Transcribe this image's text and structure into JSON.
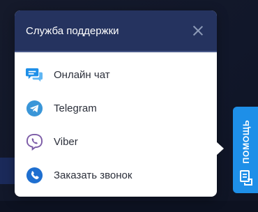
{
  "popup": {
    "title": "Служба поддержки",
    "items": [
      {
        "label": "Онлайн чат",
        "icon": "chat-bubbles-icon"
      },
      {
        "label": "Telegram",
        "icon": "telegram-icon"
      },
      {
        "label": "Viber",
        "icon": "viber-icon"
      },
      {
        "label": "Заказать звонок",
        "icon": "phone-icon"
      }
    ]
  },
  "help_tab": {
    "label": "ПОМОЩЬ",
    "icon": "support-icon"
  },
  "colors": {
    "header_bg": "#25335f",
    "accent_blue": "#1e8fe8",
    "telegram_blue": "#3a96d8",
    "viber_purple": "#7b5aa6",
    "page_bg": "#131a2c"
  }
}
